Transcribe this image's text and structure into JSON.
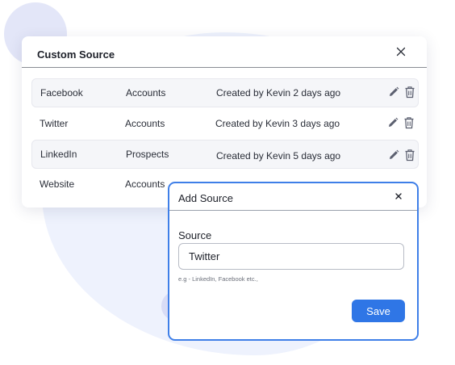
{
  "card": {
    "title": "Custom Source",
    "close_icon": "close-icon",
    "rows": [
      {
        "source": "Facebook",
        "type": "Accounts",
        "created": "Created by Kevin 2 days ago",
        "shaded": true
      },
      {
        "source": "Twitter",
        "type": "Accounts",
        "created": "Created by Kevin 3 days ago",
        "shaded": false
      },
      {
        "source": "LinkedIn",
        "type": "Prospects",
        "created": "Created by Kevin 5 days ago",
        "shaded": true
      },
      {
        "source": "Website",
        "type": "Accounts",
        "created": "",
        "shaded": false
      }
    ],
    "row_icons": [
      "pencil-icon",
      "trash-icon"
    ]
  },
  "modal": {
    "title": "Add Source",
    "field_label": "Source",
    "input_value": "Twitter",
    "hint": "e.g - LinkedIn, Facebook etc.,",
    "save_label": "Save"
  },
  "colors": {
    "accent": "#2f76e6",
    "modal_border": "#3f7fe8",
    "background_blob": "#eef2fd"
  }
}
